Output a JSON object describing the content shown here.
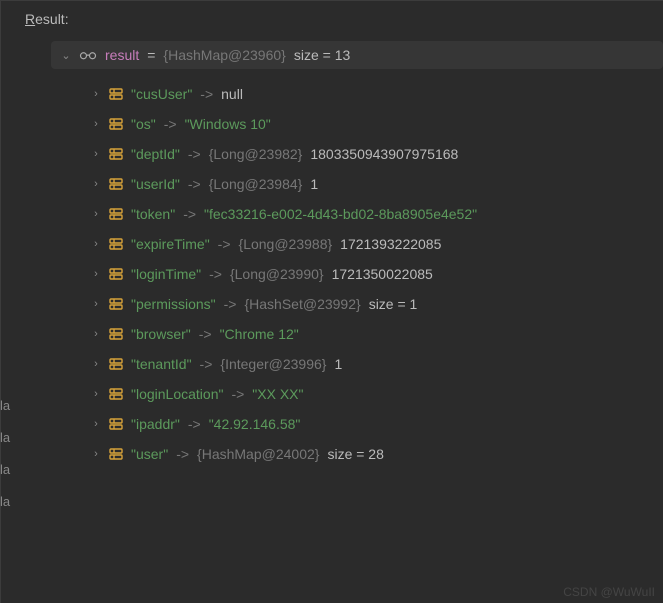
{
  "header": {
    "prefix": "R",
    "rest": "esult:"
  },
  "result": {
    "var_name": "result",
    "eq": "=",
    "type_ref": "{HashMap@23960}",
    "size_label": "size = 13"
  },
  "entries": [
    {
      "key": "\"cusUser\"",
      "arrow": "->",
      "type": null,
      "value": "null",
      "cls": "val-null"
    },
    {
      "key": "\"os\"",
      "arrow": "->",
      "type": null,
      "value": "\"Windows 10\"",
      "cls": "val-str"
    },
    {
      "key": "\"deptId\"",
      "arrow": "->",
      "type": "{Long@23982}",
      "value": "1803350943907975168",
      "cls": "val-plain"
    },
    {
      "key": "\"userId\"",
      "arrow": "->",
      "type": "{Long@23984}",
      "value": "1",
      "cls": "val-plain"
    },
    {
      "key": "\"token\"",
      "arrow": "->",
      "type": null,
      "value": "\"fec33216-e002-4d43-bd02-8ba8905e4e52\"",
      "cls": "val-str"
    },
    {
      "key": "\"expireTime\"",
      "arrow": "->",
      "type": "{Long@23988}",
      "value": "1721393222085",
      "cls": "val-plain"
    },
    {
      "key": "\"loginTime\"",
      "arrow": "->",
      "type": "{Long@23990}",
      "value": "1721350022085",
      "cls": "val-plain"
    },
    {
      "key": "\"permissions\"",
      "arrow": "->",
      "type": "{HashSet@23992}",
      "value": " size = 1",
      "cls": "val-plain"
    },
    {
      "key": "\"browser\"",
      "arrow": "->",
      "type": null,
      "value": "\"Chrome 12\"",
      "cls": "val-str"
    },
    {
      "key": "\"tenantId\"",
      "arrow": "->",
      "type": "{Integer@23996}",
      "value": "1",
      "cls": "val-plain"
    },
    {
      "key": "\"loginLocation\"",
      "arrow": "->",
      "type": null,
      "value": "\"XX XX\"",
      "cls": "val-str"
    },
    {
      "key": "\"ipaddr\"",
      "arrow": "->",
      "type": null,
      "value": "\"42.92.146.58\"",
      "cls": "val-str"
    },
    {
      "key": "\"user\"",
      "arrow": "->",
      "type": "{HashMap@24002}",
      "value": " size = 28",
      "cls": "val-plain"
    }
  ],
  "chevron_down": "⌄",
  "chevron_right": "›",
  "watermark": "CSDN @WuWuII"
}
